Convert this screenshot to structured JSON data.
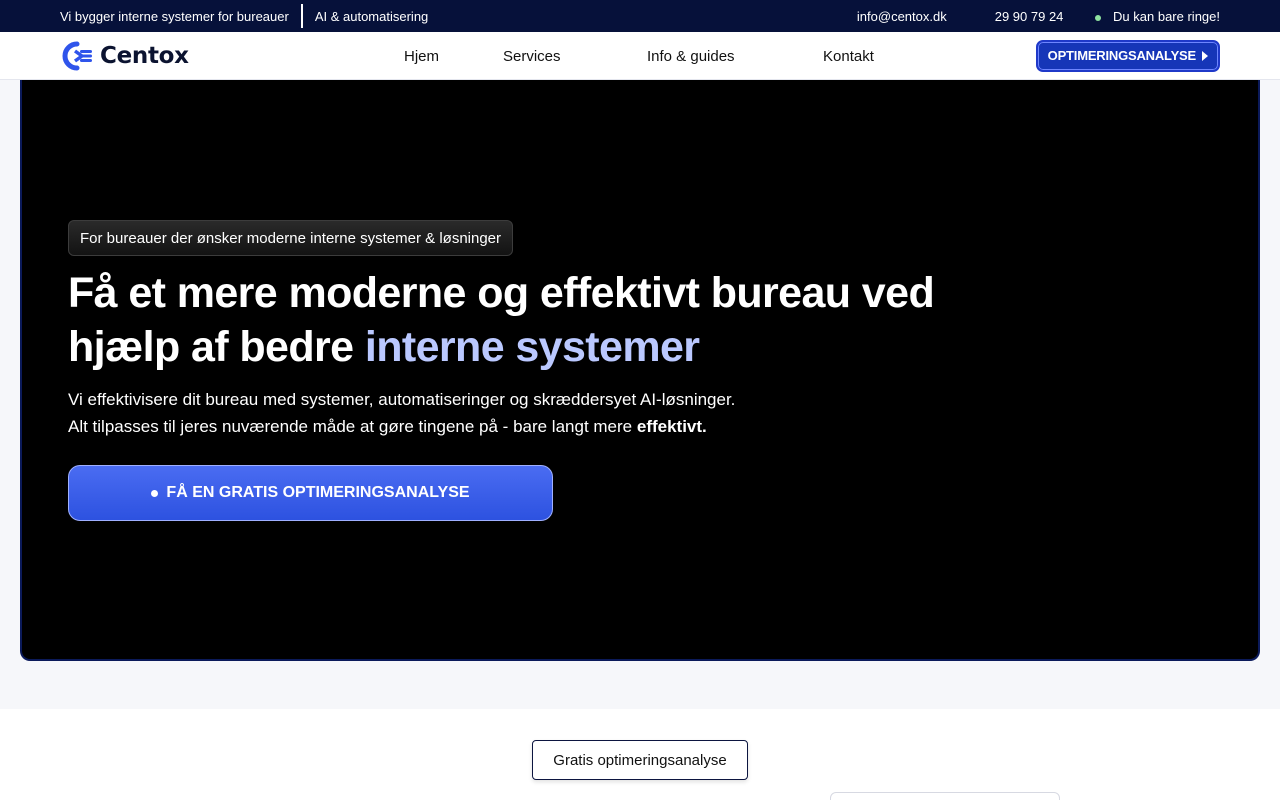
{
  "topbar": {
    "tagline": "Vi bygger interne systemer for bureauer",
    "service": "AI & automatisering",
    "email": "info@centox.dk",
    "phone": "29 90 79 24",
    "call_note": "Du kan bare ringe!"
  },
  "nav": {
    "logo_text": "Centox",
    "items": [
      "Hjem",
      "Services",
      "Info & guides",
      "Kontakt"
    ],
    "cta": "OPTIMERINGSANALYSE"
  },
  "hero": {
    "badge": "For bureauer der ønsker moderne interne systemer & løsninger",
    "headline_main": "Få et mere moderne og effektivt bureau ved hjælp af bedre ",
    "headline_highlight": "interne systemer",
    "sub_line1": "Vi effektivisere dit bureau med systemer, automatiseringer og skræddersyet AI-løsninger.",
    "sub_line2": "Alt tilpasses til jeres nuværende måde at gøre tingene på - bare langt mere ",
    "sub_bold": "effektivt.",
    "cta": "FÅ EN GRATIS OPTIMERINGSANALYSE"
  },
  "section": {
    "pill": "Gratis optimeringsanalyse"
  },
  "colors": {
    "topbar_bg": "#06113a",
    "accent": "#2d52e0",
    "highlight": "#bac8ff",
    "hero_bg": "#000000"
  }
}
